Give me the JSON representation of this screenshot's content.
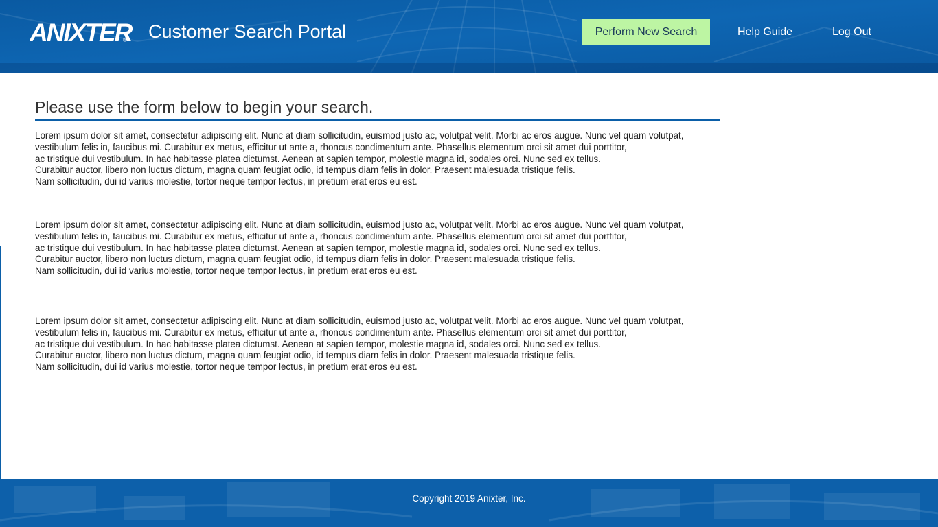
{
  "header": {
    "logo_text": "ANIXTER",
    "logo_mark": "®",
    "portal_title": "Customer Search Portal",
    "nav": {
      "new_search": "Perform New Search",
      "help": "Help Guide",
      "logout": "Log Out"
    }
  },
  "main": {
    "heading": "Please use the form below to begin your search.",
    "paragraphs": [
      {
        "lines": [
          "Lorem ipsum dolor sit amet, consectetur adipiscing elit. Nunc at diam sollicitudin, euismod justo ac, volutpat velit. Morbi ac eros augue. Nunc vel quam volutpat,",
          "vestibulum felis in, faucibus mi. Curabitur ex metus, efficitur ut ante a, rhoncus condimentum ante. Phasellus elementum orci sit amet dui porttitor,",
          "ac tristique dui vestibulum. In hac habitasse platea dictumst. Aenean at sapien tempor, molestie magna id, sodales orci. Nunc sed ex tellus.",
          "Curabitur auctor, libero non luctus dictum, magna quam feugiat odio, id tempus diam felis in dolor. Praesent malesuada tristique felis.",
          "Nam sollicitudin, dui id varius molestie, tortor neque tempor lectus, in pretium erat eros eu est."
        ]
      },
      {
        "lines": [
          "Lorem ipsum dolor sit amet, consectetur adipiscing elit. Nunc at diam sollicitudin, euismod justo ac, volutpat velit. Morbi ac eros augue. Nunc vel quam volutpat,",
          "vestibulum felis in, faucibus mi. Curabitur ex metus, efficitur ut ante a, rhoncus condimentum ante. Phasellus elementum orci sit amet dui porttitor,",
          "ac tristique dui vestibulum. In hac habitasse platea dictumst. Aenean at sapien tempor, molestie magna id, sodales orci. Nunc sed ex tellus.",
          "Curabitur auctor, libero non luctus dictum, magna quam feugiat odio, id tempus diam felis in dolor. Praesent malesuada tristique felis.",
          "Nam sollicitudin, dui id varius molestie, tortor neque tempor lectus, in pretium erat eros eu est."
        ]
      },
      {
        "lines": [
          "Lorem ipsum dolor sit amet, consectetur adipiscing elit. Nunc at diam sollicitudin, euismod justo ac, volutpat velit. Morbi ac eros augue. Nunc vel quam volutpat,",
          "vestibulum felis in, faucibus mi. Curabitur ex metus, efficitur ut ante a, rhoncus condimentum ante. Phasellus elementum orci sit amet dui porttitor,",
          "ac tristique dui vestibulum. In hac habitasse platea dictumst. Aenean at sapien tempor, molestie magna id, sodales orci. Nunc sed ex tellus.",
          "Curabitur auctor, libero non luctus dictum, magna quam feugiat odio, id tempus diam felis in dolor. Praesent malesuada tristique felis.",
          "Nam sollicitudin, dui id varius molestie, tortor neque tempor lectus, in pretium erat eros eu est."
        ]
      }
    ]
  },
  "footer": {
    "copyright": "Copyright 2019 Anixter, Inc."
  },
  "colors": {
    "brand_blue": "#0b5fa8",
    "highlight_green": "#bdf5a3"
  }
}
